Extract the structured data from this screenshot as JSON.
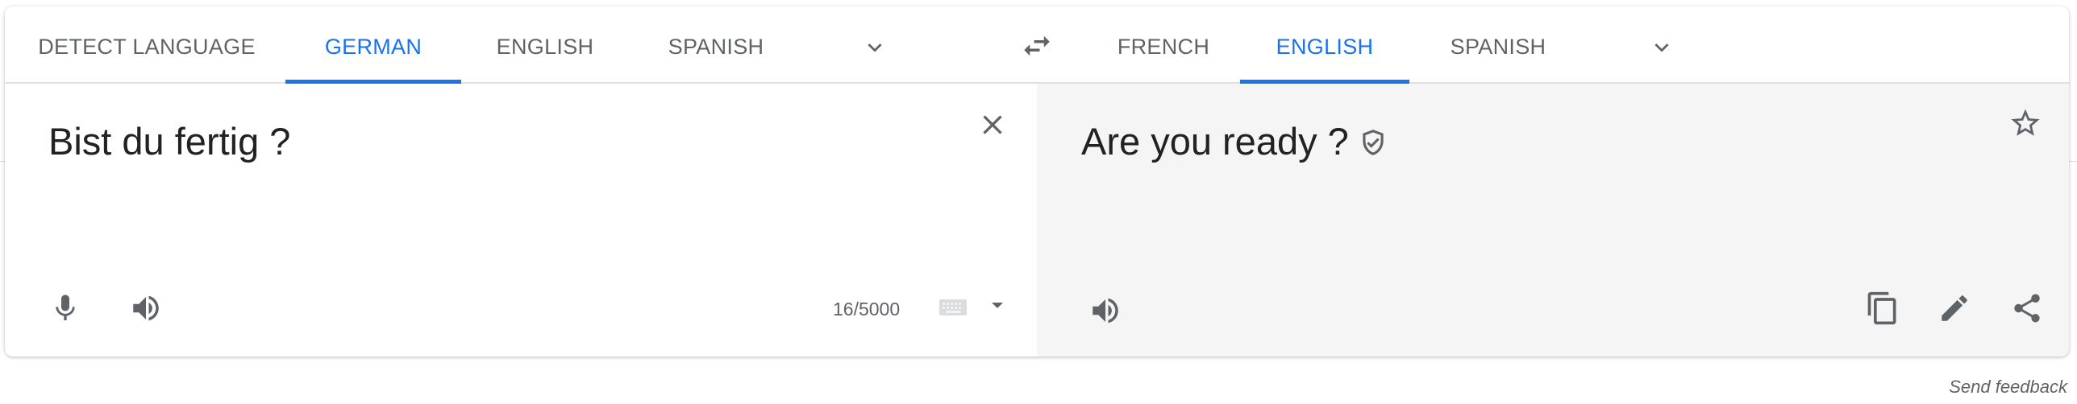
{
  "source_languages": {
    "tabs": [
      {
        "label": "DETECT LANGUAGE",
        "active": false
      },
      {
        "label": "GERMAN",
        "active": true
      },
      {
        "label": "ENGLISH",
        "active": false
      },
      {
        "label": "SPANISH",
        "active": false
      }
    ],
    "more_icon": "chevron-down-icon"
  },
  "swap_icon": "swap-arrows-icon",
  "target_languages": {
    "tabs": [
      {
        "label": "FRENCH",
        "active": false
      },
      {
        "label": "ENGLISH",
        "active": true
      },
      {
        "label": "SPANISH",
        "active": false
      }
    ],
    "more_icon": "chevron-down-icon"
  },
  "source": {
    "text": "Bist du fertig ?",
    "char_count": "16/5000",
    "icons": [
      "clear-icon",
      "microphone-icon",
      "speaker-icon",
      "keyboard-icon",
      "dropdown-arrow-icon"
    ]
  },
  "target": {
    "text": "Are you ready ?",
    "icons": [
      "verified-shield-icon",
      "star-icon",
      "speaker-icon",
      "copy-icon",
      "edit-icon",
      "share-icon"
    ]
  },
  "feedback_label": "Send feedback",
  "colors": {
    "accent": "#1a73e8",
    "icon": "#5f6368",
    "target_bg": "#f5f5f5"
  }
}
